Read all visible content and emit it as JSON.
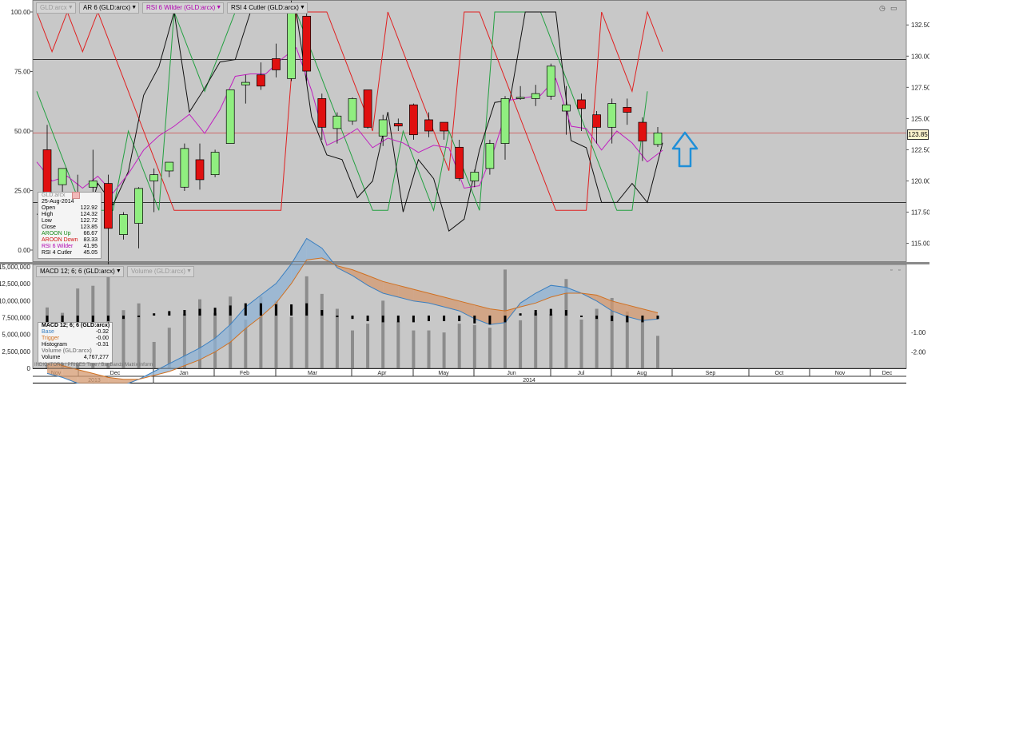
{
  "price_panel": {
    "chips": [
      {
        "label": "GLD:arcx",
        "muted": true
      },
      {
        "label": "AR 6 (GLD:arcx)",
        "muted": false
      },
      {
        "label": "RSI 6 Wilder (GLD:arcx)",
        "muted": false,
        "color": "#b000b0"
      },
      {
        "label": "RSI 4 Cutler (GLD:arcx)",
        "muted": false
      }
    ],
    "right_icons": [
      "clock-icon",
      "window-icon"
    ]
  },
  "lower_panel": {
    "chips": [
      {
        "label": "MACD 12; 6; 6 (GLD:arcx)",
        "muted": false
      },
      {
        "label": "Volume (GLD:arcx)",
        "muted": true
      }
    ],
    "right_icons": [
      "minimize-icon",
      "maximize-icon"
    ]
  },
  "price_legend": {
    "title": "GLD:arcx",
    "date": "25-Aug-2014",
    "rows": [
      {
        "label": "Open",
        "value": "122.92",
        "color": "#000000"
      },
      {
        "label": "High",
        "value": "124.32",
        "color": "#000000"
      },
      {
        "label": "Low",
        "value": "122.72",
        "color": "#000000"
      },
      {
        "label": "Close",
        "value": "123.85",
        "color": "#000000"
      },
      {
        "label": "AROON Up",
        "value": "66.67",
        "color": "#1a8a1a"
      },
      {
        "label": "AROON Down",
        "value": "83.33",
        "color": "#d01010"
      },
      {
        "label": "RSI 6 Wilder",
        "value": "41.95",
        "color": "#b000b0"
      },
      {
        "label": "RSI 4 Cutler",
        "value": "45.05",
        "color": "#000000"
      }
    ]
  },
  "macd_legend": {
    "title": "MACD 12; 6; 6 (GLD:arcx)",
    "rows": [
      {
        "label": "Base",
        "value": "-0.32",
        "color": "#3a7fc0"
      },
      {
        "label": "Trigger",
        "value": "-0.00",
        "color": "#d07020"
      },
      {
        "label": "Histogram",
        "value": "-0.31",
        "color": "#000000"
      }
    ],
    "vol_title": "Volume (GLD:arcx)",
    "vol_row": {
      "label": "Volume",
      "value": "4,767,277"
    }
  },
  "footer_text": "INDICATORS / PRICES  Time / Bar  Bands  Matrix  Inform",
  "last_price_tag": "123.85",
  "axes": {
    "price_left_ticks": [
      "100.00",
      "75.00",
      "50.00",
      "25.00",
      "0.00"
    ],
    "price_right_ticks": [
      "132.50",
      "130.00",
      "127.50",
      "125.00",
      "122.50",
      "120.00",
      "117.50",
      "115.00"
    ],
    "volume_left_ticks": [
      "15,000,000",
      "12,500,000",
      "10,000,000",
      "7,500,000",
      "5,000,000",
      "2,500,000",
      "0"
    ],
    "macd_right_ticks": [
      "-1.00",
      "-2.00"
    ],
    "months": [
      "Nov",
      "Dec",
      "Jan",
      "Feb",
      "Mar",
      "Apr",
      "May",
      "Jun",
      "Jul",
      "Aug",
      "Sep",
      "Oct",
      "Nov",
      "Dec"
    ],
    "years": [
      "2013",
      "2014"
    ]
  },
  "chart_data": {
    "type": "candlestick",
    "title": "",
    "price_range": [
      113.5,
      134.5
    ],
    "oscillator_range": [
      -7,
      101
    ],
    "candles": [
      {
        "o": 122.5,
        "h": 124.5,
        "l": 119.5,
        "c": 118.0
      },
      {
        "o": 119.7,
        "h": 121.0,
        "l": 117.5,
        "c": 121.0
      },
      {
        "o": 118.7,
        "h": 120.5,
        "l": 117.5,
        "c": 119.0
      },
      {
        "o": 119.5,
        "h": 122.5,
        "l": 116.5,
        "c": 120.0
      },
      {
        "o": 119.8,
        "h": 120.5,
        "l": 113.3,
        "c": 116.2
      },
      {
        "o": 115.7,
        "h": 117.5,
        "l": 115.3,
        "c": 117.3
      },
      {
        "o": 116.6,
        "h": 119.5,
        "l": 114.6,
        "c": 119.4
      },
      {
        "o": 120.0,
        "h": 121.0,
        "l": 117.5,
        "c": 120.5
      },
      {
        "o": 120.8,
        "h": 121.5,
        "l": 120.3,
        "c": 121.5
      },
      {
        "o": 119.5,
        "h": 123.0,
        "l": 119.2,
        "c": 122.6
      },
      {
        "o": 121.7,
        "h": 123.0,
        "l": 119.3,
        "c": 120.1
      },
      {
        "o": 120.5,
        "h": 122.5,
        "l": 120.3,
        "c": 122.3
      },
      {
        "o": 123.0,
        "h": 127.3,
        "l": 123.0,
        "c": 127.3
      },
      {
        "o": 127.7,
        "h": 128.5,
        "l": 126.2,
        "c": 127.9
      },
      {
        "o": 128.5,
        "h": 129.5,
        "l": 127.3,
        "c": 127.6
      },
      {
        "o": 129.8,
        "h": 131.0,
        "l": 128.3,
        "c": 128.9
      },
      {
        "o": 128.2,
        "h": 135.0,
        "l": 128.0,
        "c": 134.2
      },
      {
        "o": 133.2,
        "h": 134.0,
        "l": 128.0,
        "c": 128.8
      },
      {
        "o": 126.6,
        "h": 127.0,
        "l": 123.3,
        "c": 124.3
      },
      {
        "o": 124.2,
        "h": 125.5,
        "l": 123.0,
        "c": 125.2
      },
      {
        "o": 124.8,
        "h": 126.7,
        "l": 124.5,
        "c": 126.6
      },
      {
        "o": 127.3,
        "h": 127.3,
        "l": 124.2,
        "c": 124.3
      },
      {
        "o": 123.6,
        "h": 125.3,
        "l": 122.8,
        "c": 124.9
      },
      {
        "o": 124.6,
        "h": 125.0,
        "l": 124.0,
        "c": 124.4
      },
      {
        "o": 126.1,
        "h": 126.2,
        "l": 123.3,
        "c": 123.7
      },
      {
        "o": 124.9,
        "h": 125.5,
        "l": 123.5,
        "c": 124.0
      },
      {
        "o": 124.7,
        "h": 124.7,
        "l": 123.3,
        "c": 124.0
      },
      {
        "o": 122.7,
        "h": 123.3,
        "l": 120.0,
        "c": 120.2
      },
      {
        "o": 120.0,
        "h": 120.9,
        "l": 119.5,
        "c": 120.7
      },
      {
        "o": 121.0,
        "h": 123.3,
        "l": 120.5,
        "c": 123.0
      },
      {
        "o": 123.0,
        "h": 126.8,
        "l": 121.7,
        "c": 126.6
      },
      {
        "o": 126.6,
        "h": 127.6,
        "l": 126.5,
        "c": 126.7
      },
      {
        "o": 126.6,
        "h": 127.7,
        "l": 126.0,
        "c": 127.0
      },
      {
        "o": 126.8,
        "h": 129.4,
        "l": 126.5,
        "c": 129.2
      },
      {
        "o": 125.6,
        "h": 127.6,
        "l": 123.7,
        "c": 126.1
      },
      {
        "o": 126.5,
        "h": 127.0,
        "l": 124.0,
        "c": 125.8
      },
      {
        "o": 125.3,
        "h": 125.6,
        "l": 123.0,
        "c": 124.3
      },
      {
        "o": 124.3,
        "h": 126.6,
        "l": 123.0,
        "c": 126.2
      },
      {
        "o": 125.9,
        "h": 126.6,
        "l": 124.5,
        "c": 125.5
      },
      {
        "o": 124.7,
        "h": 125.1,
        "l": 121.6,
        "c": 123.2
      },
      {
        "o": 122.92,
        "h": 124.32,
        "l": 122.72,
        "c": 123.85
      }
    ],
    "aroon_up": [
      66.67,
      50,
      33.33,
      16.67,
      16.67,
      16.67,
      50,
      33.33,
      16.67,
      100,
      83.33,
      66.67,
      83.33,
      100,
      100,
      100,
      100,
      100,
      83.33,
      66.67,
      50,
      33.33,
      16.67,
      16.67,
      50,
      33.33,
      16.67,
      50,
      33.33,
      16.67,
      100,
      100,
      100,
      100,
      83.33,
      66.67,
      50,
      33.33,
      16.67,
      16.67,
      66.67
    ],
    "aroon_down": [
      100,
      83.33,
      100,
      83.33,
      100,
      83.33,
      66.67,
      50,
      33.33,
      16.67,
      16.67,
      16.67,
      16.67,
      16.67,
      16.67,
      16.67,
      16.67,
      100,
      100,
      100,
      83.33,
      66.67,
      50,
      100,
      83.33,
      66.67,
      50,
      33.33,
      100,
      100,
      83.33,
      66.67,
      50,
      33.33,
      16.67,
      16.67,
      16.67,
      100,
      83.33,
      66.67,
      100,
      83.33
    ],
    "rsi6_wilder": [
      37,
      29,
      31,
      26,
      31,
      24,
      32,
      42,
      48,
      52,
      57,
      49,
      59,
      73,
      74,
      74,
      80,
      85,
      67,
      44,
      47,
      51,
      43,
      47,
      45,
      41,
      44,
      43,
      26,
      27,
      43,
      63,
      64,
      65,
      72,
      52,
      51,
      42,
      50,
      45,
      37,
      41.95
    ],
    "rsi4_cutler": [
      15,
      16,
      4,
      6,
      28,
      19,
      33,
      65,
      77,
      100,
      58,
      68,
      79,
      80,
      100,
      100,
      100,
      100,
      56,
      40,
      38,
      22,
      29,
      58,
      16,
      38,
      30,
      8,
      13,
      42,
      62,
      63,
      100,
      100,
      100,
      46,
      43,
      20,
      20,
      28,
      20,
      45.05
    ],
    "volume_millions": [
      9.0,
      8.2,
      11.8,
      12.2,
      13.6,
      8.6,
      9.6,
      3.9,
      6.0,
      8.0,
      10.2,
      8.2,
      10.6,
      7.2,
      10.6,
      10.0,
      7.6,
      13.6,
      11.0,
      8.8,
      5.6,
      6.6,
      10.0,
      6.9,
      5.6,
      5.6,
      5.3,
      6.6,
      6.4,
      6.0,
      14.6,
      7.1,
      8.2,
      8.0,
      13.2,
      7.2,
      8.8,
      10.4,
      8.4,
      7.1,
      4.8
    ],
    "macd_base": [
      -3.1,
      -3.3,
      -3.6,
      -3.8,
      -3.8,
      -3.7,
      -3.4,
      -3.0,
      -2.6,
      -2.2,
      -1.8,
      -1.3,
      -0.6,
      0.3,
      0.9,
      1.5,
      2.5,
      3.8,
      3.3,
      2.3,
      1.9,
      1.4,
      1.0,
      0.8,
      0.6,
      0.5,
      0.3,
      0.1,
      -0.3,
      -0.6,
      -0.5,
      0.5,
      1.0,
      1.4,
      1.3,
      1.0,
      0.6,
      0.1,
      -0.2,
      -0.4,
      -0.32
    ],
    "macd_trigger": [
      -2.4,
      -2.7,
      -2.9,
      -3.1,
      -3.3,
      -3.4,
      -3.4,
      -3.2,
      -3.0,
      -2.7,
      -2.4,
      -2.0,
      -1.5,
      -0.8,
      -0.2,
      0.5,
      1.5,
      2.7,
      2.8,
      2.4,
      2.2,
      1.9,
      1.6,
      1.4,
      1.2,
      1.0,
      0.8,
      0.6,
      0.4,
      0.2,
      0.1,
      0.3,
      0.5,
      0.8,
      1.0,
      1.0,
      0.9,
      0.6,
      0.4,
      0.2,
      -0.0
    ],
    "macd_histogram": [
      -0.7,
      -0.6,
      -0.7,
      -0.7,
      -0.5,
      -0.3,
      0.0,
      0.2,
      0.4,
      0.5,
      0.6,
      0.7,
      0.9,
      1.1,
      1.1,
      1.0,
      1.0,
      1.1,
      0.5,
      -0.1,
      -0.3,
      -0.5,
      -0.6,
      -0.6,
      -0.6,
      -0.5,
      -0.5,
      -0.5,
      -0.7,
      -0.8,
      -0.6,
      0.2,
      0.5,
      0.6,
      0.5,
      0.0,
      -0.3,
      -0.5,
      -0.6,
      -0.6,
      -0.31
    ],
    "horizontal_levels_oscillator": [
      80,
      20
    ],
    "last_price_line": 123.85,
    "annotation": "up-arrow (blue)"
  }
}
